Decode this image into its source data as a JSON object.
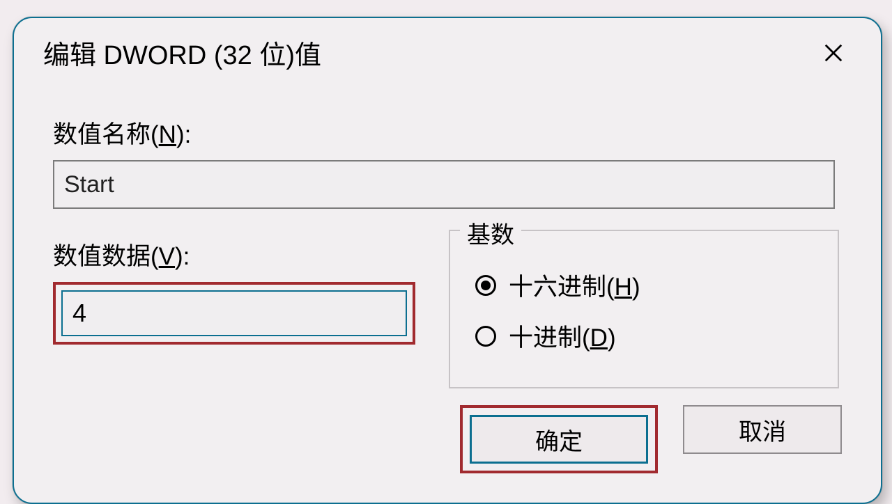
{
  "dialog": {
    "title": "编辑 DWORD (32 位)值",
    "labels": {
      "value_name_prefix": "数值名称(",
      "value_name_mnemonic": "N",
      "value_name_suffix": "):",
      "value_data_prefix": "数值数据(",
      "value_data_mnemonic": "V",
      "value_data_suffix": "):",
      "base_legend": "基数"
    },
    "fields": {
      "value_name": "Start",
      "value_data": "4"
    },
    "radios": {
      "hex_prefix": "十六进制(",
      "hex_mnemonic": "H",
      "hex_suffix": ")",
      "dec_prefix": "十进制(",
      "dec_mnemonic": "D",
      "dec_suffix": ")",
      "selected": "hex"
    },
    "buttons": {
      "ok": "确定",
      "cancel": "取消"
    }
  }
}
